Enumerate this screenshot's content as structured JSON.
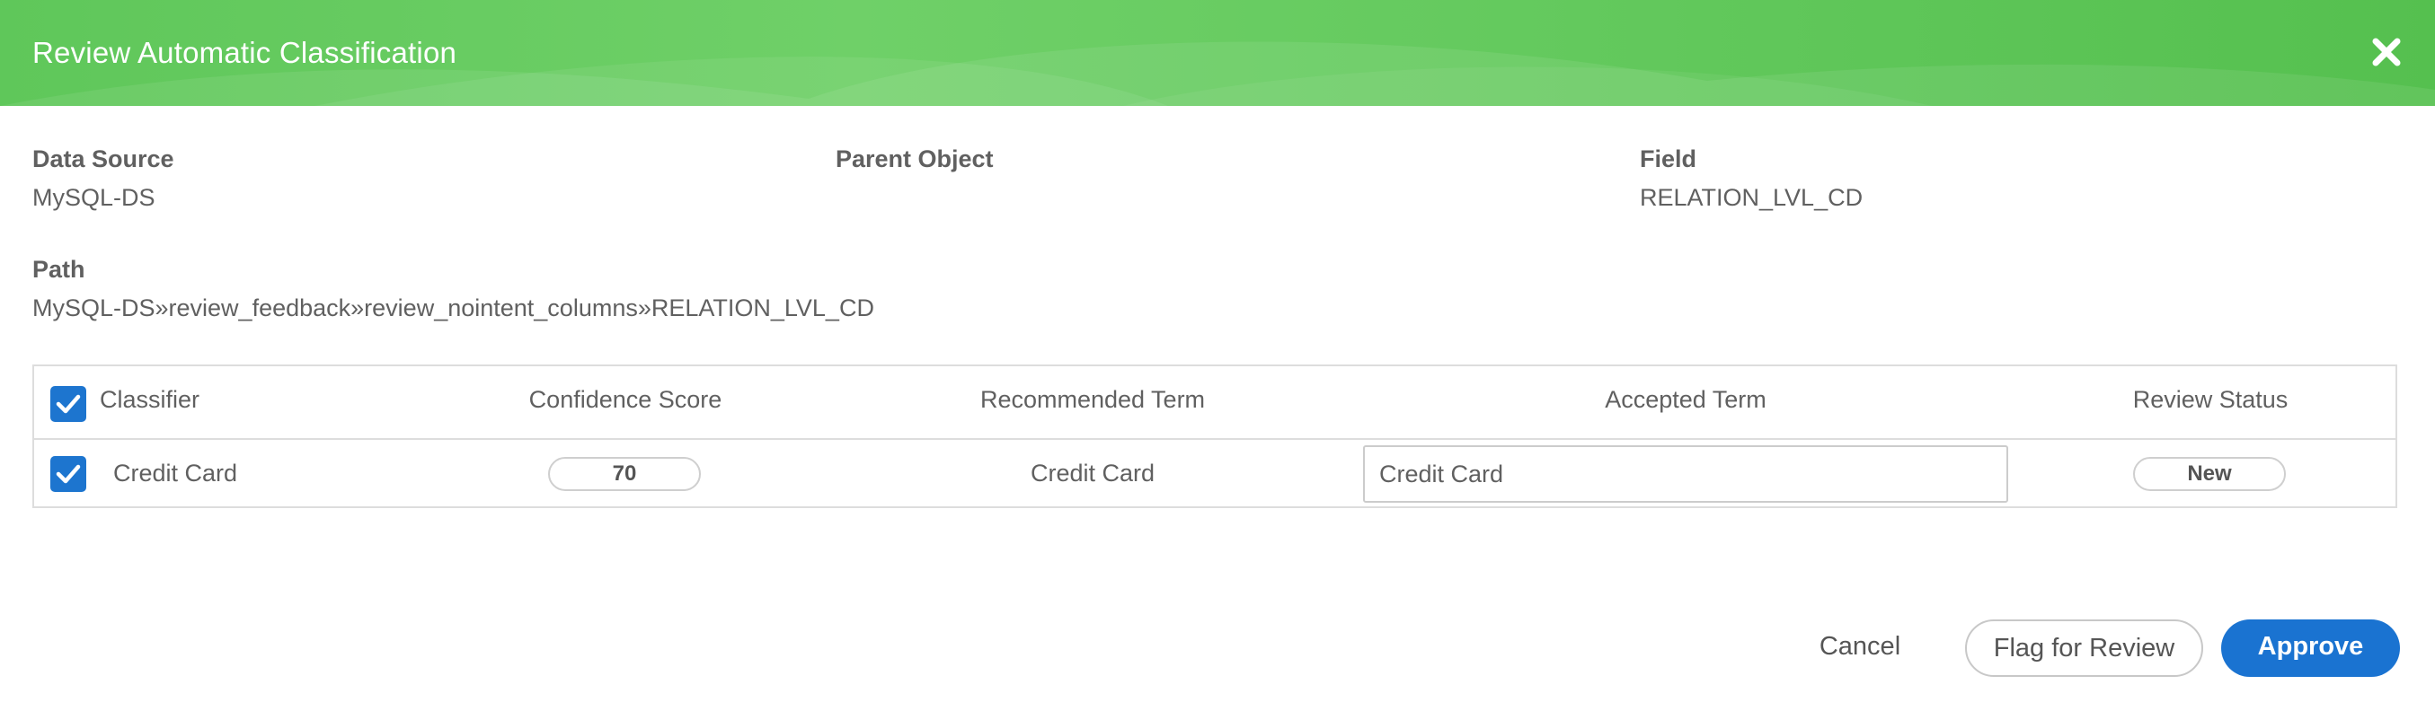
{
  "dialog": {
    "title": "Review Automatic Classification"
  },
  "details": {
    "data_source": {
      "label": "Data Source",
      "value": "MySQL-DS"
    },
    "parent_object": {
      "label": "Parent Object",
      "value": ""
    },
    "field": {
      "label": "Field",
      "value": "RELATION_LVL_CD"
    },
    "path": {
      "label": "Path",
      "value": "MySQL-DS»review_feedback»review_nointent_columns»RELATION_LVL_CD"
    }
  },
  "table": {
    "columns": [
      "Classifier",
      "Confidence Score",
      "Recommended Term",
      "Accepted Term",
      "Review Status"
    ],
    "rows": [
      {
        "classifier": "Credit Card",
        "confidence_score": "70",
        "recommended_term": "Credit Card",
        "accepted_term": "Credit Card",
        "review_status": "New",
        "checked": true
      }
    ],
    "select_all_checked": true
  },
  "footer": {
    "cancel_label": "Cancel",
    "flag_label": "Flag for Review",
    "approve_label": "Approve"
  },
  "colors": {
    "header_green": "#5fc75a",
    "primary_blue": "#1a73d1",
    "checkbox_blue": "#1d75cf"
  },
  "icons": {
    "close": "close-icon",
    "check": "check-icon"
  }
}
